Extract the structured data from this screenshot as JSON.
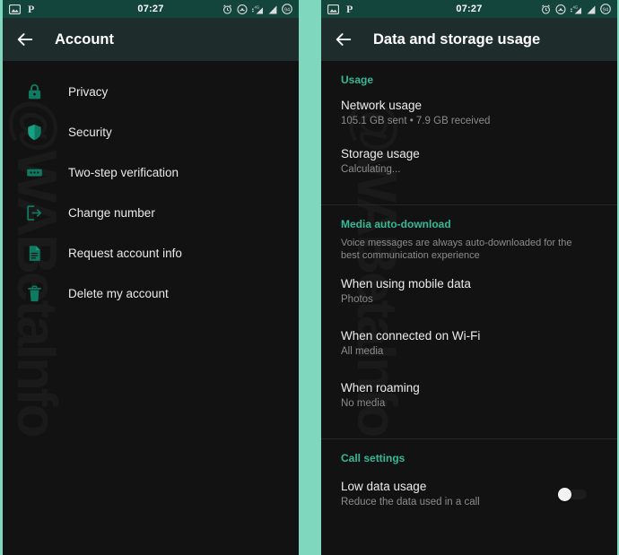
{
  "statusbar": {
    "clock": "07:27",
    "battery_level": "94",
    "left_icons": [
      "photo-icon",
      "pinterest-icon"
    ],
    "right_icons": [
      "alarm-icon",
      "cast-icon",
      "mobile-data-icon",
      "signal-icon",
      "battery-icon"
    ]
  },
  "watermark": "@WABetaInfo",
  "colors": {
    "accent_teal": "#7fd7be",
    "status_bar": "#14453c",
    "app_bar": "#1f2c2c",
    "section_header": "#37b897",
    "background": "#121212",
    "icon_teal": "#0f7a62"
  },
  "left_screen": {
    "title": "Account",
    "back_label": "Back",
    "items": [
      {
        "label": "Privacy",
        "icon": "lock-icon"
      },
      {
        "label": "Security",
        "icon": "shield-icon"
      },
      {
        "label": "Two-step verification",
        "icon": "keypad-icon"
      },
      {
        "label": "Change number",
        "icon": "change-number-icon"
      },
      {
        "label": "Request account info",
        "icon": "document-icon"
      },
      {
        "label": "Delete my account",
        "icon": "trash-icon"
      }
    ]
  },
  "right_screen": {
    "title": "Data and storage usage",
    "back_label": "Back",
    "sections": [
      {
        "header": "Usage",
        "items": [
          {
            "title": "Network usage",
            "subtitle": "105.1 GB sent • 7.9 GB received"
          },
          {
            "title": "Storage usage",
            "subtitle": "Calculating..."
          }
        ]
      },
      {
        "header": "Media auto-download",
        "blurb": "Voice messages are always auto-downloaded for the best communication experience",
        "items": [
          {
            "title": "When using mobile data",
            "subtitle": "Photos"
          },
          {
            "title": "When connected on Wi-Fi",
            "subtitle": "All media"
          },
          {
            "title": "When roaming",
            "subtitle": "No media"
          }
        ]
      },
      {
        "header": "Call settings",
        "items": [
          {
            "title": "Low data usage",
            "subtitle": "Reduce the data used in a call",
            "toggle": "off"
          }
        ]
      }
    ]
  }
}
